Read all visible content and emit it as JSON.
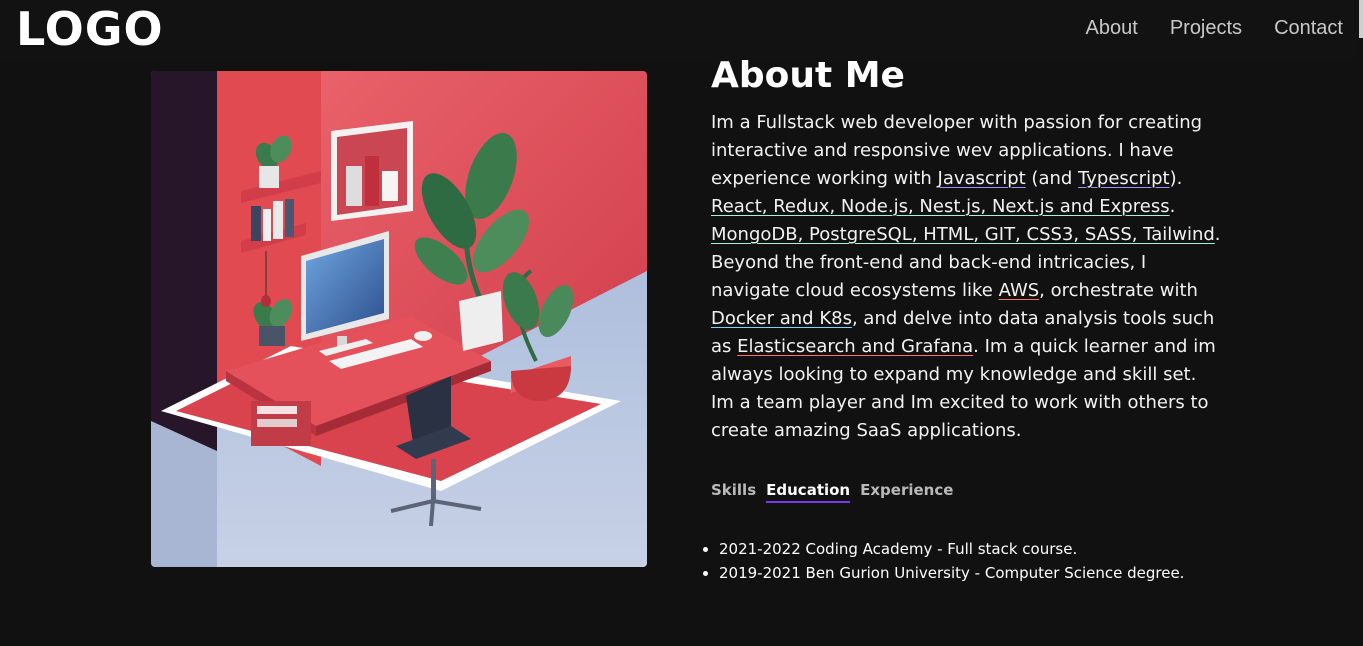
{
  "nav": {
    "logo": "LOGO",
    "links": [
      "About",
      "Projects",
      "Contact"
    ]
  },
  "about": {
    "title": "About Me",
    "bio": [
      {
        "text": "Im a Fullstack web developer with passion for creating interactive and responsive wev applications. I have experience working with "
      },
      {
        "text": "Javascript",
        "link": true,
        "color": "#a78bfa"
      },
      {
        "text": " (and "
      },
      {
        "text": "Typescript",
        "link": true,
        "color": "#a78bfa"
      },
      {
        "text": "). "
      },
      {
        "text": "React, Redux, Node.js, Nest.js, Next.js and Express",
        "link": true,
        "color": "#a7f3d0"
      },
      {
        "text": ". "
      },
      {
        "text": "MongoDB, PostgreSQL, HTML, GIT, CSS3, SASS, Tailwind",
        "link": true,
        "color": "#a7f3d0"
      },
      {
        "text": ". Beyond the front-end and back-end intricacies, I navigate cloud ecosystems like "
      },
      {
        "text": "AWS",
        "link": true,
        "color": "#f87171"
      },
      {
        "text": ", orchestrate with "
      },
      {
        "text": "Docker and K8s",
        "link": true,
        "color": "#7dd3fc"
      },
      {
        "text": ", and delve into data analysis tools such as "
      },
      {
        "text": "Elasticsearch and Grafana",
        "link": true,
        "color": "#f87171"
      },
      {
        "text": ". Im a quick learner and im always looking to expand my knowledge and skill set. Im a team player and Im excited to work with others to create amazing SaaS applications."
      }
    ]
  },
  "tabs": [
    {
      "label": "Skills",
      "active": false
    },
    {
      "label": "Education",
      "active": true
    },
    {
      "label": "Experience",
      "active": false
    }
  ],
  "education": [
    "2021-2022 Coding Academy - Full stack course.",
    "2019-2021 Ben Gurion University - Computer Science degree."
  ],
  "colors": {
    "background": "#111111",
    "navbar": "#121212",
    "tab_underline": "#7c3aed",
    "illustration_red": "#e0484f",
    "illustration_floor": "#b9c8e2"
  }
}
